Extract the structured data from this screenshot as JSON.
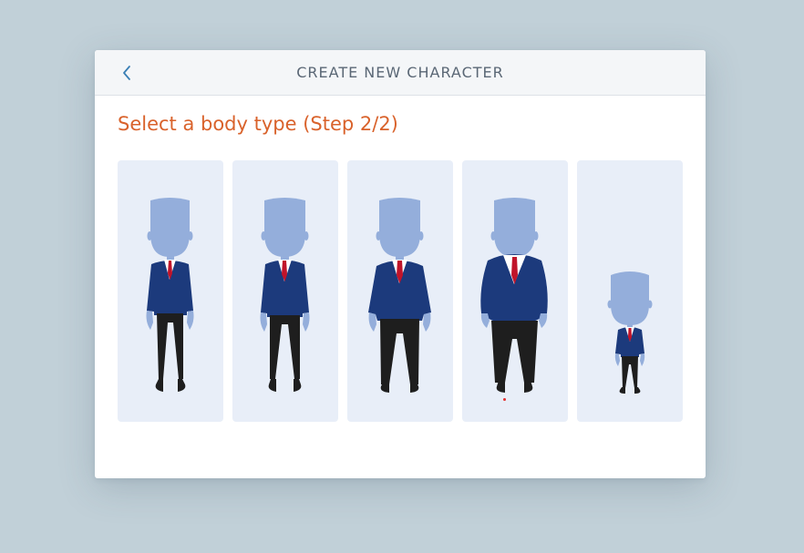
{
  "dialog": {
    "title": "CREATE NEW CHARACTER",
    "back_icon": "chevron-left-icon"
  },
  "step": {
    "title": "Select a body type (Step 2/2)"
  },
  "body_types": [
    {
      "id": "slim"
    },
    {
      "id": "average"
    },
    {
      "id": "athletic"
    },
    {
      "id": "heavy"
    },
    {
      "id": "short"
    }
  ],
  "colors": {
    "accent": "#d9622b",
    "back_icon": "#3a7fb5",
    "card_bg": "#e8eef8",
    "skin": "#94aedb",
    "jacket": "#1c3a7c",
    "tie": "#c0142a",
    "pants": "#1e1e1e"
  }
}
